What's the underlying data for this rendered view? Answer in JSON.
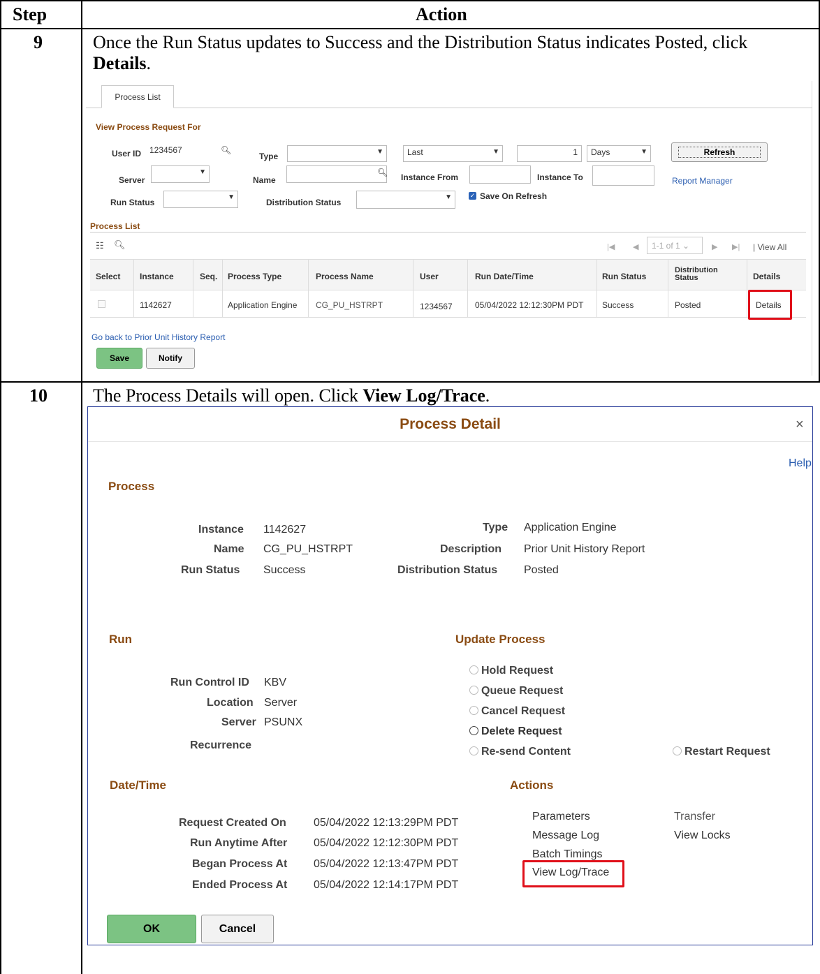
{
  "table": {
    "col_step": "Step",
    "col_action": "Action",
    "step9": "9",
    "step10": "10",
    "instr9_part1": "Once the Run Status updates to Success and the Distribution Status indicates Posted, click ",
    "instr9_bold": "Details",
    "instr9_end": ".",
    "instr10_part1": "The Process Details will open.  Click ",
    "instr10_bold": "View Log/Trace",
    "instr10_end": "."
  },
  "process_list": {
    "tab": "Process List",
    "section_title": "View Process Request For",
    "user_id_label": "User ID",
    "user_id_value": "1234567",
    "type_label": "Type",
    "type_value": "",
    "last_value": "Last",
    "days_count": "1",
    "days_value": "Days",
    "refresh": "Refresh",
    "server_label": "Server",
    "name_label": "Name",
    "instance_from_label": "Instance From",
    "instance_to_label": "Instance To",
    "report_manager": "Report Manager",
    "run_status_label": "Run Status",
    "distribution_status_label": "Distribution Status",
    "save_on_refresh": "Save On Refresh",
    "grid_title": "Process List",
    "pager": "1-1 of 1",
    "view_all": "View All",
    "columns": [
      "Select",
      "Instance",
      "Seq.",
      "Process Type",
      "Process Name",
      "User",
      "Run Date/Time",
      "Run Status",
      "Distribution",
      "Status",
      "Details"
    ],
    "row": {
      "instance": "1142627",
      "seq": "",
      "process_type": "Application Engine",
      "process_name": "CG_PU_HSTRPT",
      "user": "1234567",
      "run_datetime": "05/04/2022 12:12:30PM PDT",
      "run_status": "Success",
      "distribution_status": "Posted",
      "details": "Details"
    },
    "go_back": "Go back to Prior Unit History Report",
    "save": "Save",
    "notify": "Notify"
  },
  "process_detail": {
    "title": "Process Detail",
    "close": "×",
    "help": "Help",
    "process_header": "Process",
    "instance_label": "Instance",
    "instance_value": "1142627",
    "type_label": "Type",
    "type_value": "Application Engine",
    "name_label": "Name",
    "name_value": "CG_PU_HSTRPT",
    "description_label": "Description",
    "description_value": "Prior Unit History Report",
    "run_status_label": "Run Status",
    "run_status_value": "Success",
    "dist_status_label": "Distribution Status",
    "dist_status_value": "Posted",
    "run_header": "Run",
    "run_control_label": "Run Control ID",
    "run_control_value": "KBV",
    "location_label": "Location",
    "location_value": "Server",
    "server_label": "Server",
    "server_value": "PSUNX",
    "recurrence_label": "Recurrence",
    "update_header": "Update Process",
    "hold": "Hold Request",
    "queue": "Queue Request",
    "cancel_req": "Cancel Request",
    "delete_req": "Delete Request",
    "resend": "Re-send Content",
    "restart": "Restart Request",
    "datetime_header": "Date/Time",
    "created_label": "Request Created On",
    "created_value": "05/04/2022 12:13:29PM PDT",
    "after_label": "Run Anytime After",
    "after_value": "05/04/2022 12:12:30PM PDT",
    "began_label": "Began Process At",
    "began_value": "05/04/2022 12:13:47PM PDT",
    "ended_label": "Ended Process At",
    "ended_value": "05/04/2022 12:14:17PM PDT",
    "actions_header": "Actions",
    "parameters": "Parameters",
    "message_log": "Message Log",
    "batch_timings": "Batch Timings",
    "view_log": "View Log/Trace",
    "transfer": "Transfer",
    "view_locks": "View Locks",
    "ok": "OK",
    "cancel": "Cancel"
  }
}
